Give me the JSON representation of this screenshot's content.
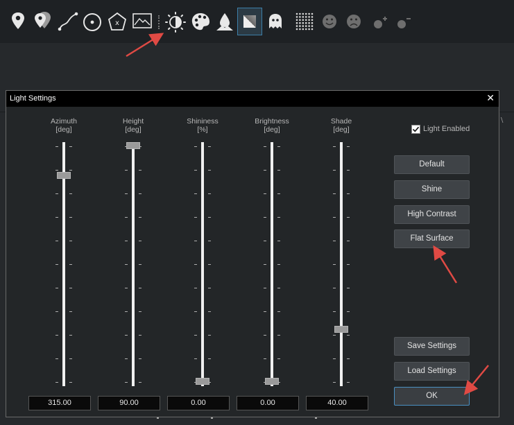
{
  "dialog": {
    "title": "Light Settings",
    "close_glyph": "✕"
  },
  "sliders": [
    {
      "name": "Azimuth",
      "unit": "[deg]",
      "value": "315.00",
      "level": 0.875
    },
    {
      "name": "Height",
      "unit": "[deg]",
      "value": "90.00",
      "level": 1.0
    },
    {
      "name": "Shininess",
      "unit": "[%]",
      "value": "0.00",
      "level": 0.0
    },
    {
      "name": "Brightness",
      "unit": "[deg]",
      "value": "0.00",
      "level": 0.0
    },
    {
      "name": "Shade",
      "unit": "[deg]",
      "value": "40.00",
      "level": 0.222
    }
  ],
  "light_enabled": {
    "label": "Light Enabled",
    "checked": true
  },
  "buttons": {
    "default": "Default",
    "shine": "Shine",
    "high_contrast": "High Contrast",
    "flat_surface": "Flat Surface",
    "save_settings": "Save Settings",
    "load_settings": "Load Settings",
    "ok": "OK"
  },
  "toolbar": {
    "icons": [
      "location-pin-icon",
      "multiple-pins-icon",
      "path-curve-icon",
      "circle-point-icon",
      "pentagon-x-icon",
      "profile-frame-icon",
      "light-settings-icon",
      "palette-icon",
      "water-terrain-icon",
      "shading-square-icon",
      "ghost-icon",
      "grid-dots-icon",
      "smiley-icon",
      "frown-icon",
      "zoom-in-dot-icon",
      "zoom-out-dot-icon"
    ],
    "selected": "shading-square-icon"
  },
  "colors": {
    "background": "#202326",
    "arrow": "#e04a44",
    "accent": "#4a90c2"
  }
}
